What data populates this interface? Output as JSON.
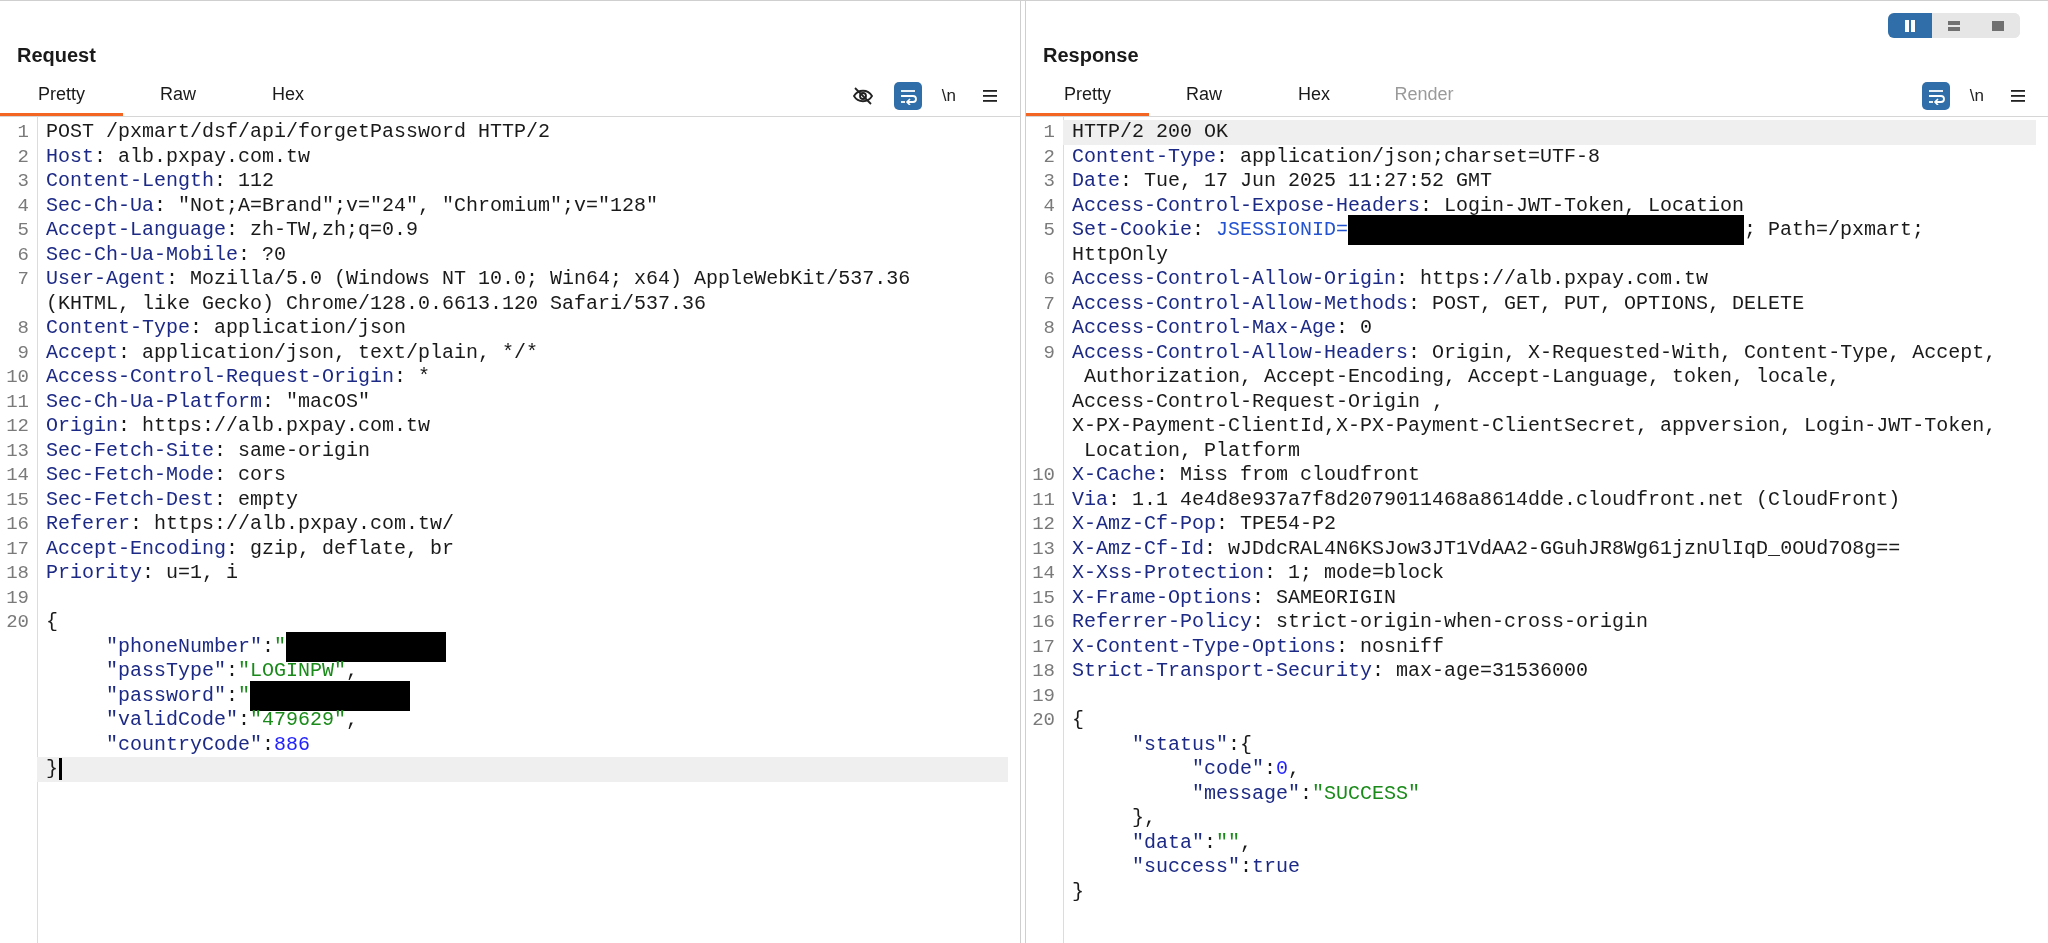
{
  "layout_toggle": [
    {
      "kind": "columns",
      "selected": true
    },
    {
      "kind": "rows",
      "selected": false
    },
    {
      "kind": "single",
      "selected": false
    }
  ],
  "panels": [
    {
      "title": "Request",
      "tabs": [
        {
          "label": "Pretty",
          "selected": true,
          "disabled": false
        },
        {
          "label": "Raw",
          "selected": false,
          "disabled": false
        },
        {
          "label": "Hex",
          "selected": false,
          "disabled": false
        }
      ],
      "toolbar": [
        {
          "kind": "eye",
          "selected": false
        },
        {
          "kind": "wrap",
          "selected": true
        },
        {
          "kind": "newline",
          "label": "\\n",
          "selected": false
        },
        {
          "kind": "menu",
          "selected": false
        }
      ],
      "lines": [
        {
          "number": "1",
          "highlighted": false,
          "cursor": false,
          "parts": [
            {
              "kind": "plain",
              "text": "POST /pxmart/dsf/api/forgetPassword HTTP/2"
            }
          ]
        },
        {
          "number": "2",
          "highlighted": false,
          "cursor": false,
          "parts": [
            {
              "kind": "key",
              "text": "Host"
            },
            {
              "kind": "plain",
              "text": ": alb.pxpay.com.tw"
            }
          ]
        },
        {
          "number": "3",
          "highlighted": false,
          "cursor": false,
          "parts": [
            {
              "kind": "key",
              "text": "Content-Length"
            },
            {
              "kind": "plain",
              "text": ": 112"
            }
          ]
        },
        {
          "number": "4",
          "highlighted": false,
          "cursor": false,
          "parts": [
            {
              "kind": "key",
              "text": "Sec-Ch-Ua"
            },
            {
              "kind": "plain",
              "text": ": \"Not;A=Brand\";v=\"24\", \"Chromium\";v=\"128\""
            }
          ]
        },
        {
          "number": "5",
          "highlighted": false,
          "cursor": false,
          "parts": [
            {
              "kind": "key",
              "text": "Accept-Language"
            },
            {
              "kind": "plain",
              "text": ": zh-TW,zh;q=0.9"
            }
          ]
        },
        {
          "number": "6",
          "highlighted": false,
          "cursor": false,
          "parts": [
            {
              "kind": "key",
              "text": "Sec-Ch-Ua-Mobile"
            },
            {
              "kind": "plain",
              "text": ": ?0"
            }
          ]
        },
        {
          "number": "7",
          "highlighted": false,
          "cursor": false,
          "parts": [
            {
              "kind": "key",
              "text": "User-Agent"
            },
            {
              "kind": "plain",
              "text": ": Mozilla/5.0 (Windows NT 10.0; Win64; x64) AppleWebKit/537.36"
            }
          ]
        },
        {
          "highlighted": false,
          "cursor": false,
          "parts": [
            {
              "kind": "plain",
              "text": "(KHTML, like Gecko) Chrome/128.0.6613.120 Safari/537.36"
            }
          ]
        },
        {
          "number": "8",
          "highlighted": false,
          "cursor": false,
          "parts": [
            {
              "kind": "key",
              "text": "Content-Type"
            },
            {
              "kind": "plain",
              "text": ": application/json"
            }
          ]
        },
        {
          "number": "9",
          "highlighted": false,
          "cursor": false,
          "parts": [
            {
              "kind": "key",
              "text": "Accept"
            },
            {
              "kind": "plain",
              "text": ": application/json, text/plain, */*"
            }
          ]
        },
        {
          "number": "10",
          "highlighted": false,
          "cursor": false,
          "parts": [
            {
              "kind": "key",
              "text": "Access-Control-Request-Origin"
            },
            {
              "kind": "plain",
              "text": ": *"
            }
          ]
        },
        {
          "number": "11",
          "highlighted": false,
          "cursor": false,
          "parts": [
            {
              "kind": "key",
              "text": "Sec-Ch-Ua-Platform"
            },
            {
              "kind": "plain",
              "text": ": \"macOS\""
            }
          ]
        },
        {
          "number": "12",
          "highlighted": false,
          "cursor": false,
          "parts": [
            {
              "kind": "key",
              "text": "Origin"
            },
            {
              "kind": "plain",
              "text": ": https://alb.pxpay.com.tw"
            }
          ]
        },
        {
          "number": "13",
          "highlighted": false,
          "cursor": false,
          "parts": [
            {
              "kind": "key",
              "text": "Sec-Fetch-Site"
            },
            {
              "kind": "plain",
              "text": ": same-origin"
            }
          ]
        },
        {
          "number": "14",
          "highlighted": false,
          "cursor": false,
          "parts": [
            {
              "kind": "key",
              "text": "Sec-Fetch-Mode"
            },
            {
              "kind": "plain",
              "text": ": cors"
            }
          ]
        },
        {
          "number": "15",
          "highlighted": false,
          "cursor": false,
          "parts": [
            {
              "kind": "key",
              "text": "Sec-Fetch-Dest"
            },
            {
              "kind": "plain",
              "text": ": empty"
            }
          ]
        },
        {
          "number": "16",
          "highlighted": false,
          "cursor": false,
          "parts": [
            {
              "kind": "key",
              "text": "Referer"
            },
            {
              "kind": "plain",
              "text": ": https://alb.pxpay.com.tw/"
            }
          ]
        },
        {
          "number": "17",
          "highlighted": false,
          "cursor": false,
          "parts": [
            {
              "kind": "key",
              "text": "Accept-Encoding"
            },
            {
              "kind": "plain",
              "text": ": gzip, deflate, br"
            }
          ]
        },
        {
          "number": "18",
          "highlighted": false,
          "cursor": false,
          "parts": [
            {
              "kind": "key",
              "text": "Priority"
            },
            {
              "kind": "plain",
              "text": ": u=1, i"
            }
          ]
        },
        {
          "number": "19",
          "highlighted": false,
          "cursor": false
        },
        {
          "number": "20",
          "highlighted": false,
          "cursor": false,
          "parts": [
            {
              "kind": "plain",
              "text": "{"
            }
          ]
        },
        {
          "highlighted": false,
          "cursor": false,
          "parts": [
            {
              "kind": "key",
              "text": "     \"phoneNumber\""
            },
            {
              "kind": "plain",
              "text": ":"
            },
            {
              "kind": "string",
              "text": "\""
            },
            {
              "kind": "redacted"
            }
          ]
        },
        {
          "highlighted": false,
          "cursor": false,
          "parts": [
            {
              "kind": "key",
              "text": "     \"passType\""
            },
            {
              "kind": "plain",
              "text": ":"
            },
            {
              "kind": "string",
              "text": "\"LOGINPW\""
            },
            {
              "kind": "plain",
              "text": ","
            }
          ]
        },
        {
          "highlighted": false,
          "cursor": false,
          "parts": [
            {
              "kind": "key",
              "text": "     \"password\""
            },
            {
              "kind": "plain",
              "text": ":"
            },
            {
              "kind": "string",
              "text": "\""
            },
            {
              "kind": "redacted"
            }
          ]
        },
        {
          "highlighted": false,
          "cursor": false,
          "parts": [
            {
              "kind": "key",
              "text": "     \"validCode\""
            },
            {
              "kind": "plain",
              "text": ":"
            },
            {
              "kind": "string",
              "text": "\"479629\""
            },
            {
              "kind": "plain",
              "text": ","
            }
          ]
        },
        {
          "highlighted": false,
          "cursor": false,
          "parts": [
            {
              "kind": "key",
              "text": "     \"countryCode\""
            },
            {
              "kind": "plain",
              "text": ":"
            },
            {
              "kind": "number",
              "text": "886"
            }
          ]
        },
        {
          "highlighted": true,
          "cursor": true,
          "parts": [
            {
              "kind": "plain",
              "text": "}"
            }
          ]
        }
      ]
    },
    {
      "title": "Response",
      "tabs": [
        {
          "label": "Pretty",
          "selected": true,
          "disabled": false
        },
        {
          "label": "Raw",
          "selected": false,
          "disabled": false
        },
        {
          "label": "Hex",
          "selected": false,
          "disabled": false
        },
        {
          "label": "Render",
          "selected": false,
          "disabled": true
        }
      ],
      "toolbar": [
        {
          "kind": "wrap",
          "selected": true
        },
        {
          "kind": "newline",
          "label": "\\n",
          "selected": false
        },
        {
          "kind": "menu",
          "selected": false
        }
      ],
      "lines": [
        {
          "number": "1",
          "highlighted": true,
          "cursor": false,
          "parts": [
            {
              "kind": "plain",
              "text": "HTTP/2 200 OK"
            }
          ]
        },
        {
          "number": "2",
          "highlighted": false,
          "cursor": false,
          "parts": [
            {
              "kind": "key",
              "text": "Content-Type"
            },
            {
              "kind": "plain",
              "text": ": application/json;charset=UTF-8"
            }
          ]
        },
        {
          "number": "3",
          "highlighted": false,
          "cursor": false,
          "parts": [
            {
              "kind": "key",
              "text": "Date"
            },
            {
              "kind": "plain",
              "text": ": Tue, 17 Jun 2025 11:27:52 GMT"
            }
          ]
        },
        {
          "number": "4",
          "highlighted": false,
          "cursor": false,
          "parts": [
            {
              "kind": "key",
              "text": "Access-Control-Expose-Headers"
            },
            {
              "kind": "plain",
              "text": ": Login-JWT-Token, Location"
            }
          ]
        },
        {
          "number": "5",
          "highlighted": false,
          "cursor": false,
          "parts": [
            {
              "kind": "key",
              "text": "Set-Cookie"
            },
            {
              "kind": "plain",
              "text": ": "
            },
            {
              "kind": "cookie",
              "text": "JSESSIONID="
            },
            {
              "kind": "redacted_wide"
            },
            {
              "kind": "plain",
              "text": "; Path=/pxmart;"
            }
          ]
        },
        {
          "highlighted": false,
          "cursor": false,
          "parts": [
            {
              "kind": "plain",
              "text": "HttpOnly"
            }
          ]
        },
        {
          "number": "6",
          "highlighted": false,
          "cursor": false,
          "parts": [
            {
              "kind": "key",
              "text": "Access-Control-Allow-Origin"
            },
            {
              "kind": "plain",
              "text": ": https://alb.pxpay.com.tw"
            }
          ]
        },
        {
          "number": "7",
          "highlighted": false,
          "cursor": false,
          "parts": [
            {
              "kind": "key",
              "text": "Access-Control-Allow-Methods"
            },
            {
              "kind": "plain",
              "text": ": POST, GET, PUT, OPTIONS, DELETE"
            }
          ]
        },
        {
          "number": "8",
          "highlighted": false,
          "cursor": false,
          "parts": [
            {
              "kind": "key",
              "text": "Access-Control-Max-Age"
            },
            {
              "kind": "plain",
              "text": ": 0"
            }
          ]
        },
        {
          "number": "9",
          "highlighted": false,
          "cursor": false,
          "parts": [
            {
              "kind": "key",
              "text": "Access-Control-Allow-Headers"
            },
            {
              "kind": "plain",
              "text": ": Origin, X-Requested-With, Content-Type, Accept,"
            }
          ]
        },
        {
          "highlighted": false,
          "cursor": false,
          "parts": [
            {
              "kind": "plain",
              "text": " Authorization, Accept-Encoding, Accept-Language, token, locale,"
            }
          ]
        },
        {
          "highlighted": false,
          "cursor": false,
          "parts": [
            {
              "kind": "plain",
              "text": "Access-Control-Request-Origin ,"
            }
          ]
        },
        {
          "highlighted": false,
          "cursor": false,
          "parts": [
            {
              "kind": "plain",
              "text": "X-PX-Payment-ClientId,X-PX-Payment-ClientSecret, appversion, Login-JWT-Token,"
            }
          ]
        },
        {
          "highlighted": false,
          "cursor": false,
          "parts": [
            {
              "kind": "plain",
              "text": " Location, Platform"
            }
          ]
        },
        {
          "number": "10",
          "highlighted": false,
          "cursor": false,
          "parts": [
            {
              "kind": "key",
              "text": "X-Cache"
            },
            {
              "kind": "plain",
              "text": ": Miss from cloudfront"
            }
          ]
        },
        {
          "number": "11",
          "highlighted": false,
          "cursor": false,
          "parts": [
            {
              "kind": "key",
              "text": "Via"
            },
            {
              "kind": "plain",
              "text": ": 1.1 4e4d8e937a7f8d2079011468a8614dde.cloudfront.net (CloudFront)"
            }
          ]
        },
        {
          "number": "12",
          "highlighted": false,
          "cursor": false,
          "parts": [
            {
              "kind": "key",
              "text": "X-Amz-Cf-Pop"
            },
            {
              "kind": "plain",
              "text": ": TPE54-P2"
            }
          ]
        },
        {
          "number": "13",
          "highlighted": false,
          "cursor": false,
          "parts": [
            {
              "kind": "key",
              "text": "X-Amz-Cf-Id"
            },
            {
              "kind": "plain",
              "text": ": wJDdcRAL4N6KSJow3JT1VdAA2-GGuhJR8Wg61jznUlIqD_0OUd7O8g=="
            }
          ]
        },
        {
          "number": "14",
          "highlighted": false,
          "cursor": false,
          "parts": [
            {
              "kind": "key",
              "text": "X-Xss-Protection"
            },
            {
              "kind": "plain",
              "text": ": 1; mode=block"
            }
          ]
        },
        {
          "number": "15",
          "highlighted": false,
          "cursor": false,
          "parts": [
            {
              "kind": "key",
              "text": "X-Frame-Options"
            },
            {
              "kind": "plain",
              "text": ": SAMEORIGIN"
            }
          ]
        },
        {
          "number": "16",
          "highlighted": false,
          "cursor": false,
          "parts": [
            {
              "kind": "key",
              "text": "Referrer-Policy"
            },
            {
              "kind": "plain",
              "text": ": strict-origin-when-cross-origin"
            }
          ]
        },
        {
          "number": "17",
          "highlighted": false,
          "cursor": false,
          "parts": [
            {
              "kind": "key",
              "text": "X-Content-Type-Options"
            },
            {
              "kind": "plain",
              "text": ": nosniff"
            }
          ]
        },
        {
          "number": "18",
          "highlighted": false,
          "cursor": false,
          "parts": [
            {
              "kind": "key",
              "text": "Strict-Transport-Security"
            },
            {
              "kind": "plain",
              "text": ": max-age=31536000"
            }
          ]
        },
        {
          "number": "19",
          "highlighted": false,
          "cursor": false
        },
        {
          "number": "20",
          "highlighted": false,
          "cursor": false,
          "parts": [
            {
              "kind": "plain",
              "text": "{"
            }
          ]
        },
        {
          "highlighted": false,
          "cursor": false,
          "parts": [
            {
              "kind": "key",
              "text": "     \"status\""
            },
            {
              "kind": "plain",
              "text": ":{"
            }
          ]
        },
        {
          "highlighted": false,
          "cursor": false,
          "parts": [
            {
              "kind": "key",
              "text": "          \"code\""
            },
            {
              "kind": "plain",
              "text": ":"
            },
            {
              "kind": "number",
              "text": "0"
            },
            {
              "kind": "plain",
              "text": ","
            }
          ]
        },
        {
          "highlighted": false,
          "cursor": false,
          "parts": [
            {
              "kind": "key",
              "text": "          \"message\""
            },
            {
              "kind": "plain",
              "text": ":"
            },
            {
              "kind": "string",
              "text": "\"SUCCESS\""
            }
          ]
        },
        {
          "highlighted": false,
          "cursor": false,
          "parts": [
            {
              "kind": "plain",
              "text": "     },"
            }
          ]
        },
        {
          "highlighted": false,
          "cursor": false,
          "parts": [
            {
              "kind": "key",
              "text": "     \"data\""
            },
            {
              "kind": "plain",
              "text": ":"
            },
            {
              "kind": "string",
              "text": "\"\""
            },
            {
              "kind": "plain",
              "text": ","
            }
          ]
        },
        {
          "highlighted": false,
          "cursor": false,
          "parts": [
            {
              "kind": "key",
              "text": "     \"success\""
            },
            {
              "kind": "plain",
              "text": ":"
            },
            {
              "kind": "key",
              "text": "true"
            }
          ]
        },
        {
          "highlighted": false,
          "cursor": false,
          "parts": [
            {
              "kind": "plain",
              "text": "}"
            }
          ]
        }
      ]
    }
  ]
}
